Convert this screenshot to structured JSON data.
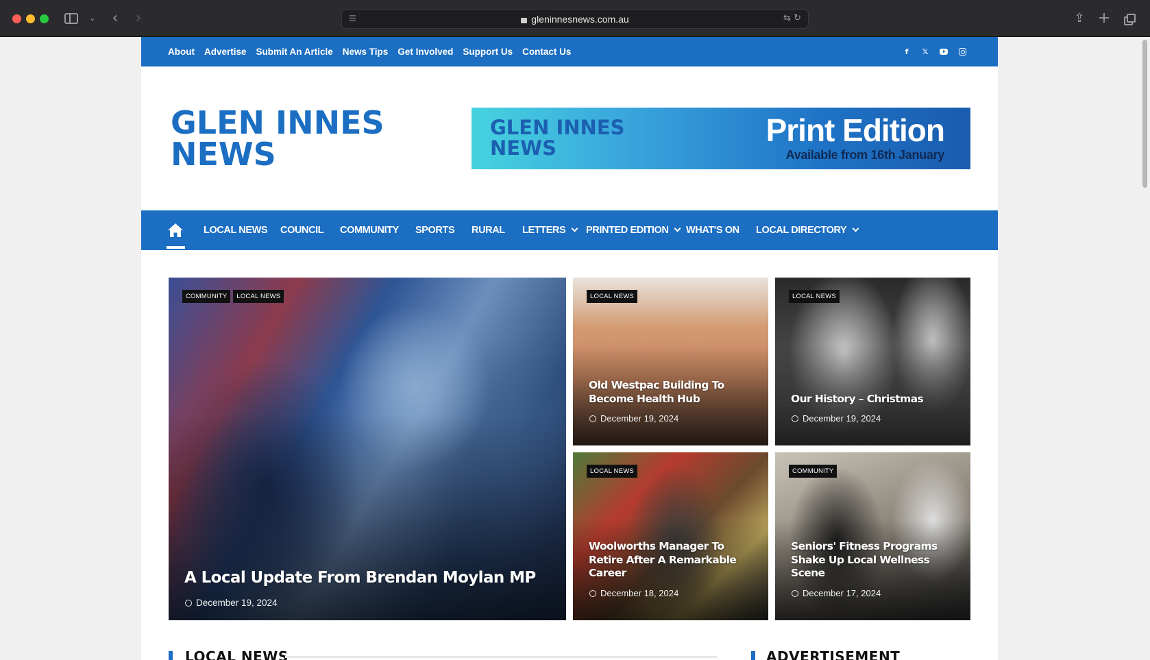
{
  "browser": {
    "url": "gleninnesnews.com.au"
  },
  "topbar": {
    "links": [
      "About",
      "Advertise",
      "Submit An Article",
      "News Tips",
      "Get Involved",
      "Support Us",
      "Contact Us"
    ],
    "social_icons": [
      "facebook-icon",
      "x-icon",
      "youtube-icon",
      "instagram-icon"
    ]
  },
  "header": {
    "logo_line1": "GLEN INNES",
    "logo_line2": "NEWS",
    "banner": {
      "logo_line1": "GLEN INNES",
      "logo_line2": "NEWS",
      "title": "Print Edition",
      "subtitle": "Available from 16th January"
    }
  },
  "mainnav": {
    "items": [
      "LOCAL NEWS",
      "COUNCIL",
      "COMMUNITY",
      "SPORTS",
      "RURAL",
      "LETTERS",
      "PRINTED EDITION",
      "WHAT'S ON",
      "LOCAL DIRECTORY"
    ]
  },
  "featured": {
    "big": {
      "tags": [
        "COMMUNITY",
        "LOCAL NEWS"
      ],
      "title": "A Local Update From Brendan Moylan MP",
      "date": "December 19, 2024"
    },
    "small": [
      {
        "tags": [
          "LOCAL NEWS"
        ],
        "title_line1": "Old Westpac Building To",
        "title_line2": "Become Health Hub",
        "title_line3": "",
        "date": "December 19, 2024"
      },
      {
        "tags": [
          "LOCAL NEWS"
        ],
        "title_line1": "Our History – Christmas",
        "title_line2": "",
        "title_line3": "",
        "date": "December 19, 2024"
      },
      {
        "tags": [
          "LOCAL NEWS"
        ],
        "title_line1": "Woolworths Manager To",
        "title_line2": "Retire After A Remarkable",
        "title_line3": "Career",
        "date": "December 18, 2024"
      },
      {
        "tags": [
          "COMMUNITY"
        ],
        "title_line1": "Seniors' Fitness Programs",
        "title_line2": "Shake Up Local Wellness",
        "title_line3": "Scene",
        "date": "December 17, 2024"
      }
    ]
  },
  "sections": {
    "left": "LOCAL NEWS",
    "right": "ADVERTISEMENT"
  },
  "colors": {
    "brand_blue": "#1b6ec2"
  }
}
